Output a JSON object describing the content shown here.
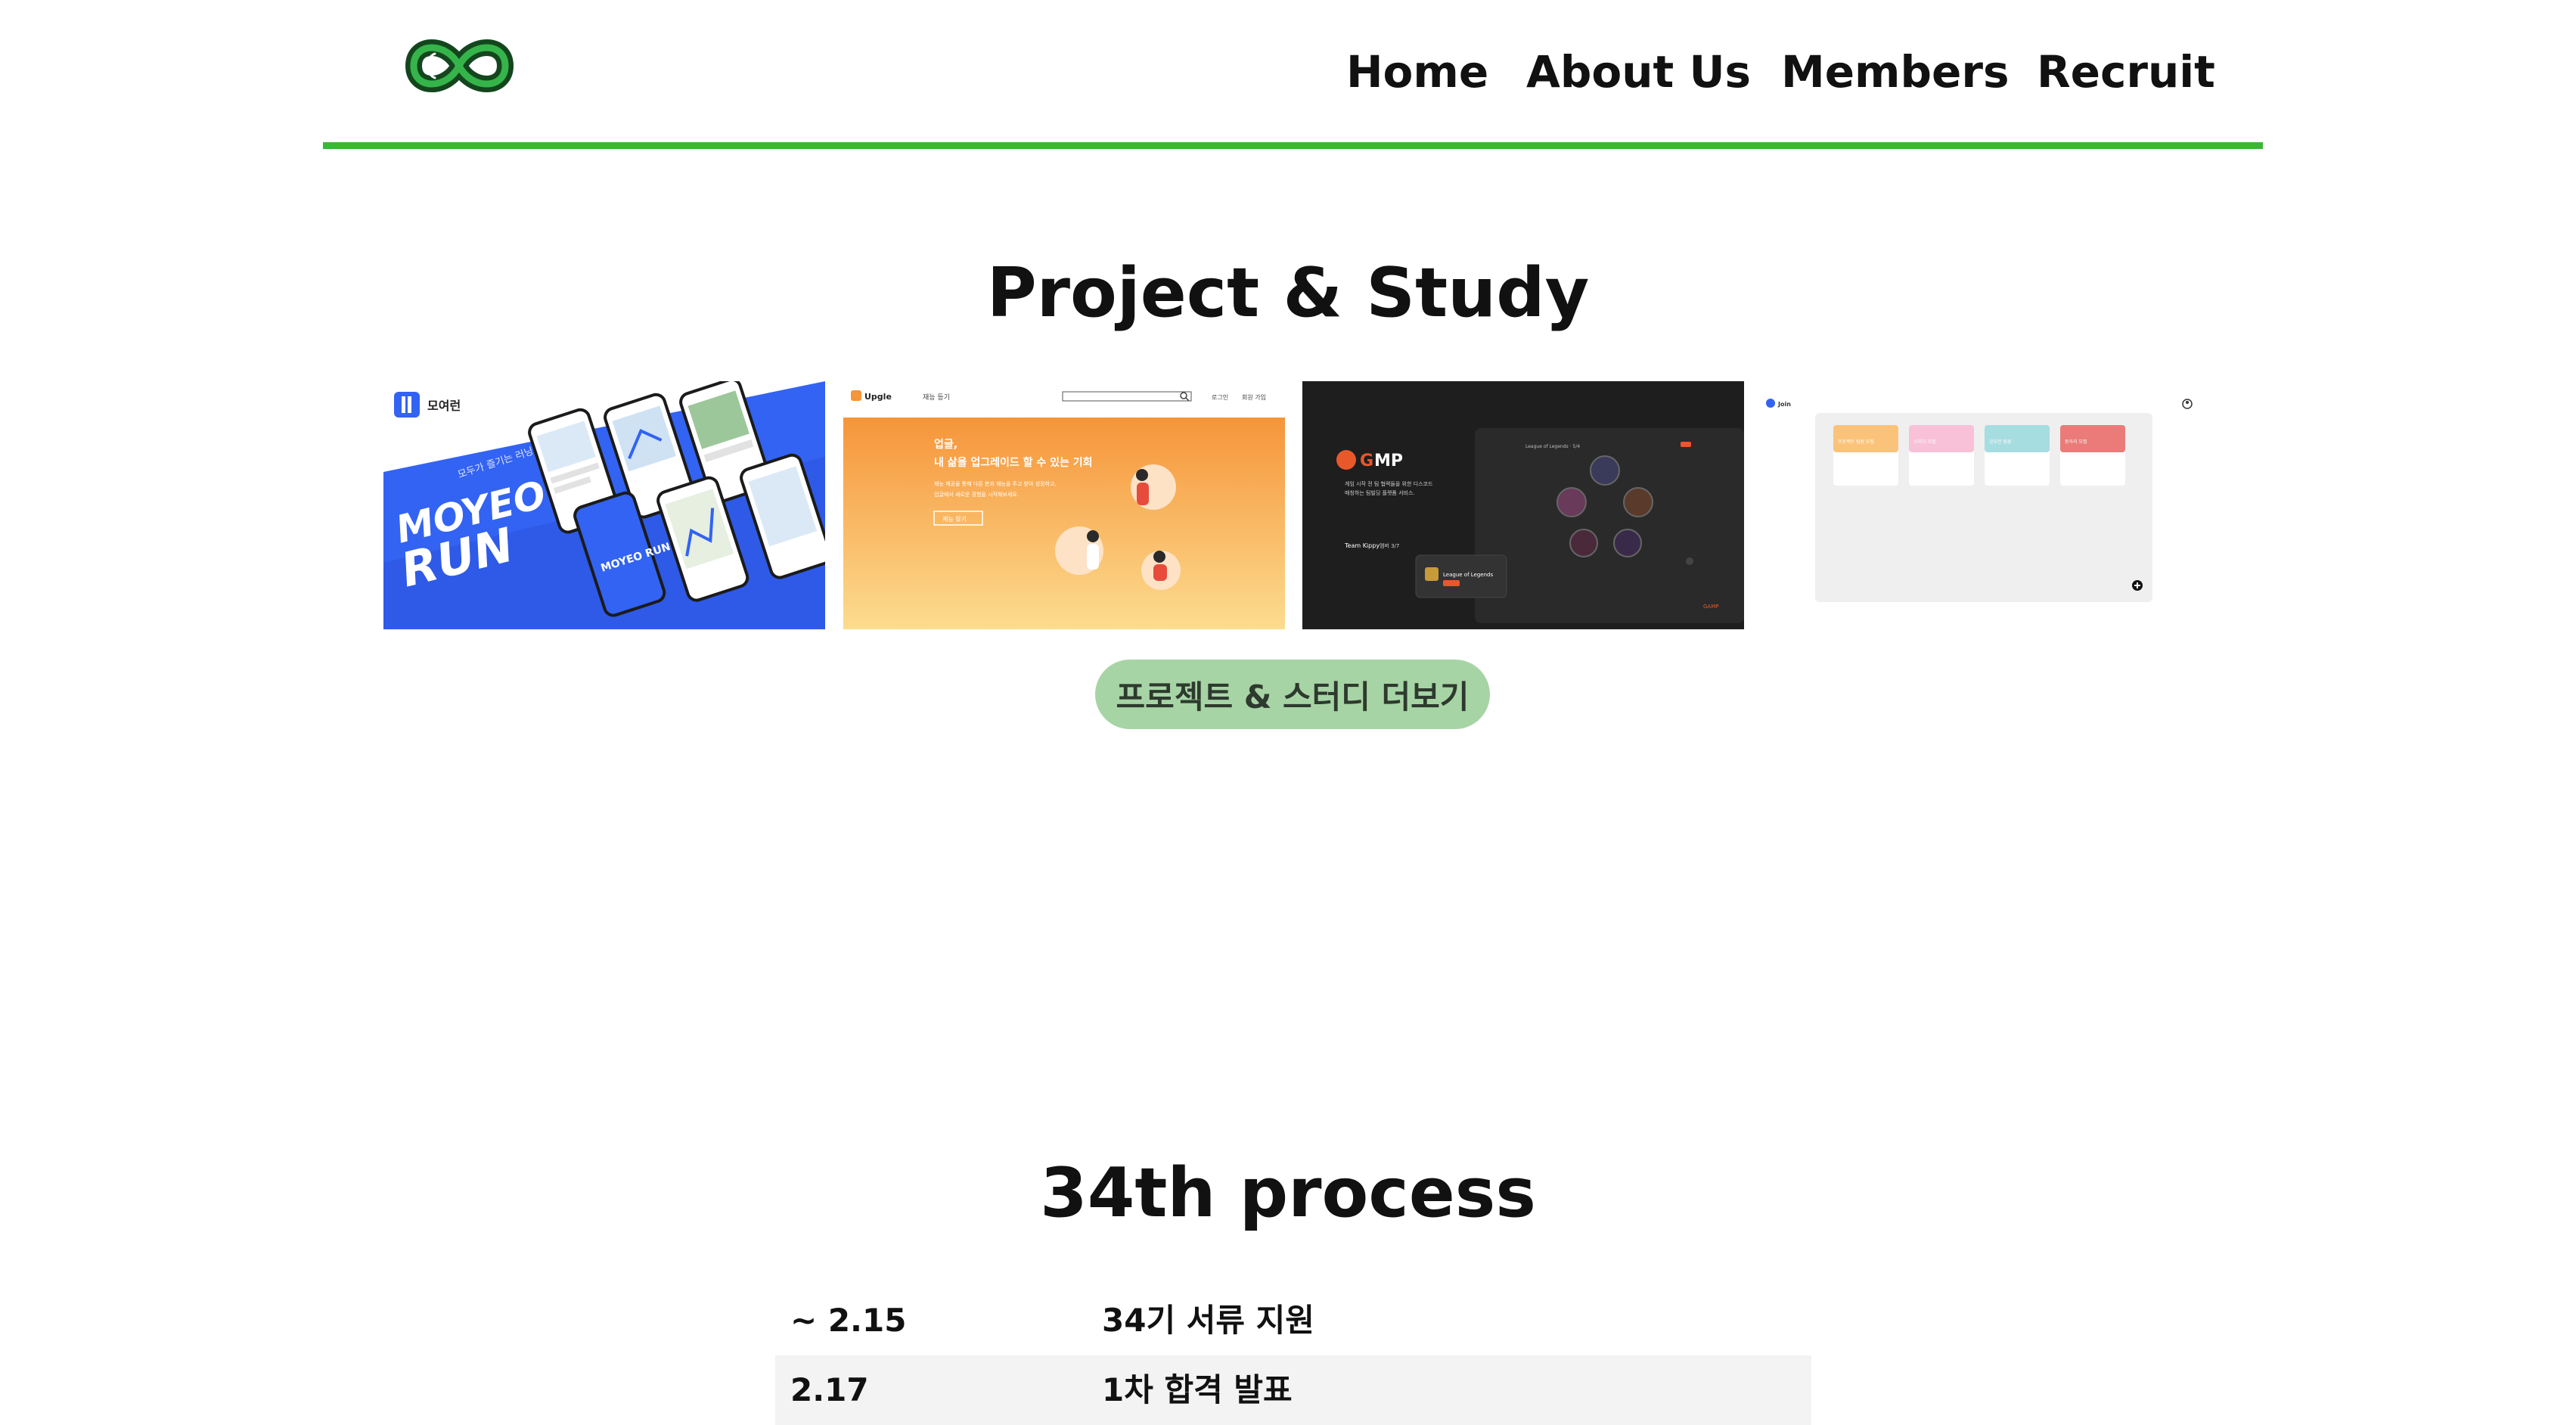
{
  "header": {
    "nav": [
      "Home",
      "About Us",
      "Members",
      "Recruit"
    ]
  },
  "projects": {
    "title": "Project & Study",
    "items": [
      {
        "app_name": "모여런",
        "tagline": "모두가 즐기는 러닝 서비스",
        "logo_text": "MOYEO RUN",
        "logo_line1": "MOYEO",
        "logo_line2": "RUN",
        "phone_logo": "MOYEO RUN"
      },
      {
        "brand": "Upgle",
        "menu": "재능 등기",
        "nav_login": "로그인",
        "nav_signup": "회원 가입",
        "headline_line1": "업글,",
        "headline_line2": "내 삶을 업그레이드 할 수 있는 기회",
        "desc_line1": "재능 제공을 통해 다른 분과 재능을 주고 받아 성장하고,",
        "desc_line2": "업글에서 새로운 경험을 시작해보세요.",
        "cta": "재능 찾기"
      },
      {
        "brand_left": "G",
        "brand_right": "MP",
        "desc_line1": "게임 시작 전 팀 협력들을 위한 디스코드",
        "desc_line2": "매칭하는 팀빌딩 플랫폼 서비스.",
        "team_label": "Team Kippy",
        "team_count": "멤버 3/7",
        "card_title": "League of Legends",
        "card_title_top": "League of Legends · 5/4",
        "footer_brand": "GAMP"
      },
      {
        "brand": "Join",
        "card_labels": [
          "프로젝트 팀원 모집",
          "스터디 모집",
          "공모전 팀원",
          "동아리 모집"
        ]
      }
    ],
    "more_button": "프로젝트 & 스터디 더보기"
  },
  "process": {
    "title": "34th process",
    "rows": [
      {
        "date": "~ 2.15",
        "label": "34기 서류 지원"
      },
      {
        "date": "2.17",
        "label": "1차 합격 발표"
      }
    ]
  },
  "colors": {
    "accent_green": "#3cb635",
    "button_green": "#a7d4a5",
    "moyeo_blue": "#3363f2",
    "upgle_orange": "#f6953a",
    "gamp_dark": "#1e1e1e",
    "join_grey": "#efefef"
  },
  "icons": [
    "infinity-logo-icon",
    "search-icon",
    "add-icon",
    "user-icon"
  ]
}
